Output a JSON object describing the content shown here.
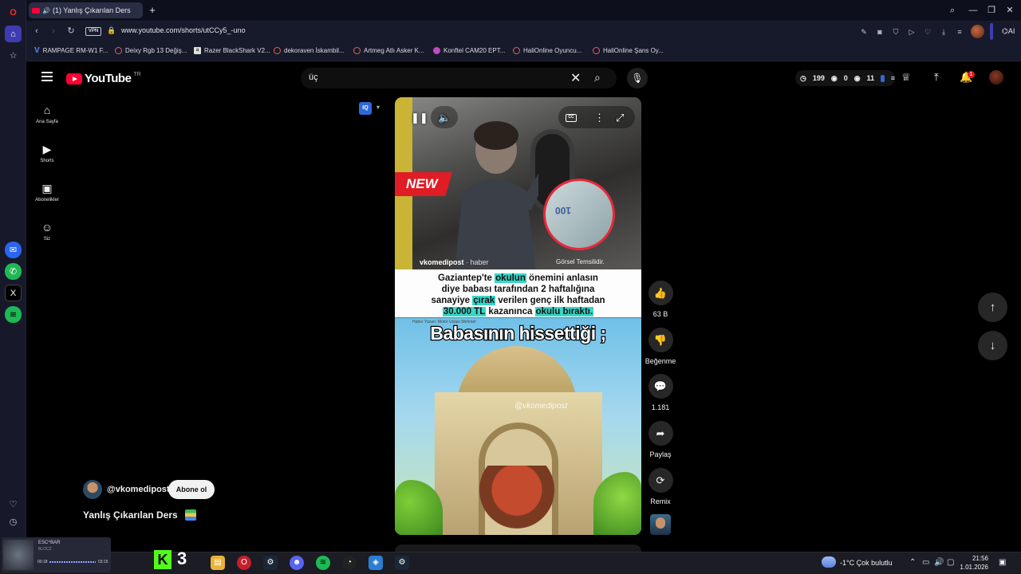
{
  "browser": {
    "tab_title": "(1) Yanlış Çıkarılan Ders",
    "url": "www.youtube.com/shorts/utCCy5_-uno",
    "vpn_label": "VPN",
    "ai_label": "AI",
    "bookmarks": [
      "RAMPAGE RM-W1 F...",
      "Deixy Rgb 13 Değiş...",
      "Razer BlackShark V2...",
      "dekoraven İskambil...",
      "Artmeg Atlı Asker K...",
      "Konftel CAM20 EPT...",
      "HaliOnline Oyuncu...",
      "HaliOnline Şans Oy..."
    ]
  },
  "youtube": {
    "logo_text": "YouTube",
    "region": "TR",
    "search_value": "üç",
    "stats": {
      "watched": "199",
      "zero": "0",
      "count": "11"
    },
    "notifications": "1",
    "guide": [
      {
        "label": "Ana Sayfa",
        "icon": "home-icon"
      },
      {
        "label": "Shorts",
        "icon": "shorts-icon"
      },
      {
        "label": "Abonelikler",
        "icon": "subscriptions-icon"
      },
      {
        "label": "Siz",
        "icon": "you-icon"
      }
    ],
    "iq_label": "IQ"
  },
  "short": {
    "new_badge": "NEW",
    "channel_caption": "vkomedipost",
    "caption_tag": "· haber",
    "image_note": "Görsel Temsilidir.",
    "caption_line1_pre": "Gaziantep'te ",
    "caption_line1_hl": "okulun",
    "caption_line1_post": " önemini anlasın",
    "caption_line2": "diye babası tarafından 2 haftalığına",
    "caption_line3_pre": "sanayiye ",
    "caption_line3_hl": "çırak",
    "caption_line3_post": " verilen genç ilk haftadan",
    "caption_line4_hl1": "30.000 TL",
    "caption_line4_mid": " kazanınca ",
    "caption_line4_hl2": "okulu bıraktı.",
    "tiny_label": "Haber Yazarı: Motor Ustası Mehmet",
    "overlay_text": "Babasının hissettiği ;",
    "watermark": "@vkomedipost",
    "cash_text": "100",
    "cc_label": "CC"
  },
  "actions": {
    "like_count": "63 B",
    "dislike_label": "Beğenme",
    "comment_count": "1.181",
    "share_label": "Paylaş",
    "remix_label": "Remix"
  },
  "channel": {
    "handle": "@vkomedipost",
    "subscribe_label": "Abone ol",
    "title": "Yanlış Çıkarılan Ders"
  },
  "taskbar": {
    "widget_title": "ESC^BAR",
    "widget_sub": "BLOCZ",
    "widget_time_start": "00:18",
    "widget_time_end": "03:15",
    "kick_letter": "K",
    "kick_number": "3",
    "weather": "-1°C  Çok bulutlu",
    "time": "21:56",
    "date": "1.01.2026"
  },
  "colors": {
    "youtube_red": "#ff0033",
    "highlight": "#36d7c7",
    "opera_accent": "#3d3cb0"
  }
}
